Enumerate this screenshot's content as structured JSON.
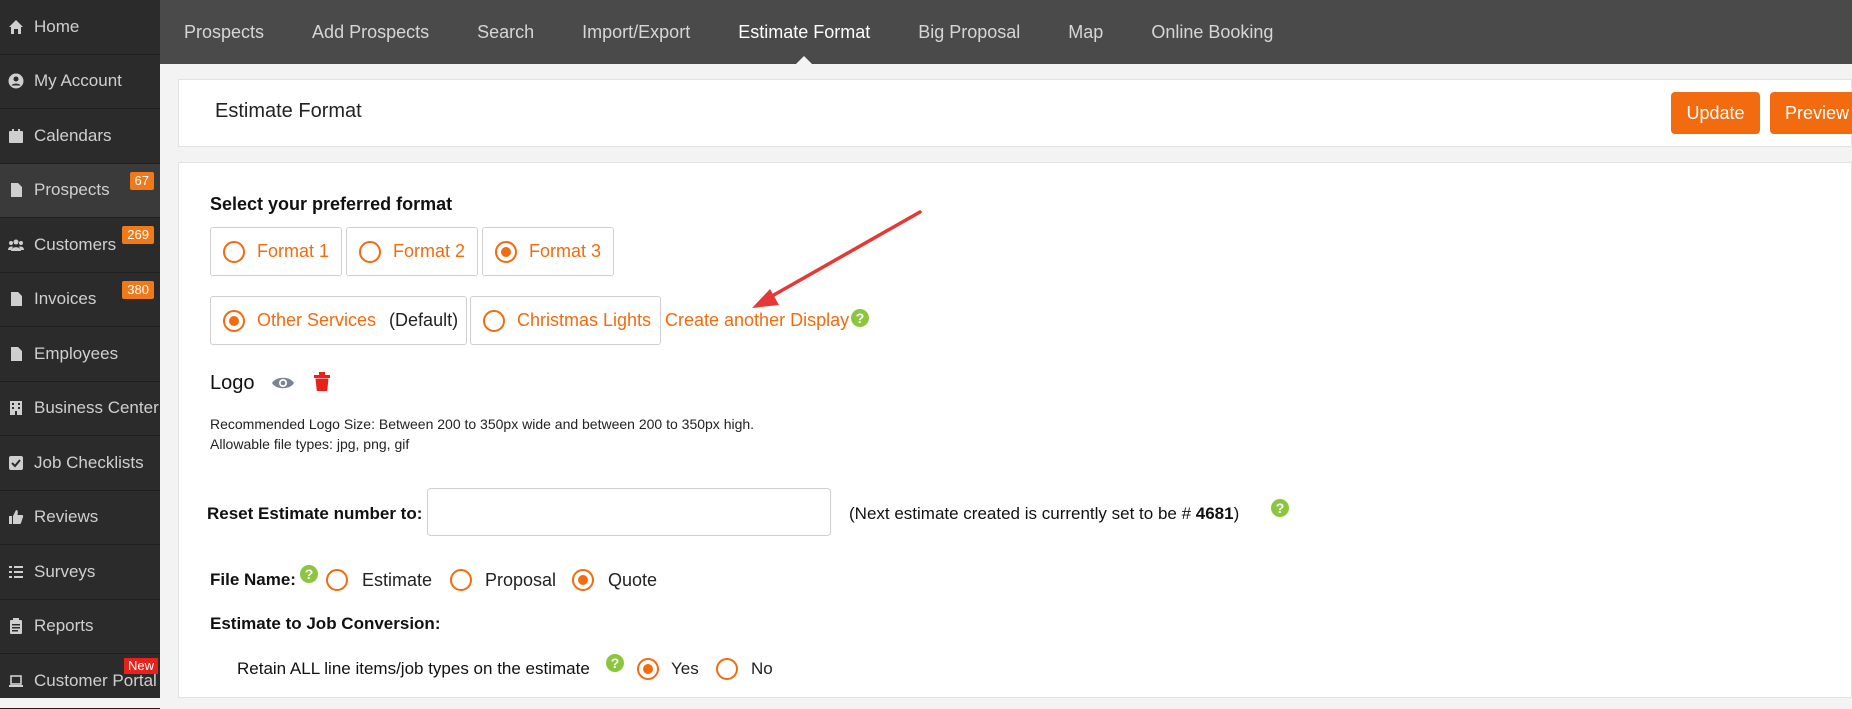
{
  "sidebar": {
    "items": [
      {
        "label": "Home",
        "icon": "home-icon"
      },
      {
        "label": "My Account",
        "icon": "user-circle-icon"
      },
      {
        "label": "Calendars",
        "icon": "calendar-icon"
      },
      {
        "label": "Prospects",
        "icon": "document-icon",
        "badge": "67"
      },
      {
        "label": "Customers",
        "icon": "users-icon",
        "badge": "269"
      },
      {
        "label": "Invoices",
        "icon": "document-icon",
        "badge": "380"
      },
      {
        "label": "Employees",
        "icon": "document-icon"
      },
      {
        "label": "Business Center",
        "icon": "building-icon"
      },
      {
        "label": "Job Checklists",
        "icon": "checkbox-icon"
      },
      {
        "label": "Reviews",
        "icon": "thumbs-up-icon"
      },
      {
        "label": "Surveys",
        "icon": "list-icon"
      },
      {
        "label": "Reports",
        "icon": "clipboard-icon"
      },
      {
        "label": "Customer Portal",
        "icon": "laptop-icon",
        "badge_new": "New"
      }
    ]
  },
  "topnav": {
    "tabs": [
      "Prospects",
      "Add Prospects",
      "Search",
      "Import/Export",
      "Estimate Format",
      "Big Proposal",
      "Map",
      "Online Booking"
    ],
    "active": "Estimate Format"
  },
  "header": {
    "title": "Estimate Format",
    "update_label": "Update",
    "preview_label": "Preview"
  },
  "format": {
    "heading": "Select your preferred format",
    "options": [
      "Format 1",
      "Format 2",
      "Format 3"
    ],
    "selected": "Format 3"
  },
  "display": {
    "options": [
      {
        "label": "Other Services",
        "suffix": "(Default)",
        "selected": true
      },
      {
        "label": "Christmas Lights",
        "suffix": "",
        "selected": false
      }
    ],
    "create_link": "Create another Display"
  },
  "logo": {
    "label": "Logo",
    "size_note": "Recommended Logo Size: Between 200 to 350px wide and between 200 to 350px high.",
    "types_note": "Allowable file types: jpg, png, gif"
  },
  "reset": {
    "label": "Reset Estimate number to:",
    "value": "",
    "note_prefix": "(Next estimate created is currently set to be # ",
    "note_number": "4681",
    "note_suffix": ")"
  },
  "file_name": {
    "label": "File Name:",
    "options": [
      "Estimate",
      "Proposal",
      "Quote"
    ],
    "selected": "Quote"
  },
  "conversion": {
    "heading": "Estimate to Job Conversion:",
    "retain_label": "Retain ALL line items/job types on the estimate",
    "options": [
      "Yes",
      "No"
    ],
    "selected": "Yes"
  },
  "colors": {
    "accent": "#f26b0f",
    "sidebar_bg": "#2b2b2b",
    "topnav_bg": "#4a4a4a",
    "help_green": "#8cc63f",
    "delete_red": "#e8221b",
    "badge_orange": "#f07a1a",
    "annotation_arrow": "#e53935"
  }
}
